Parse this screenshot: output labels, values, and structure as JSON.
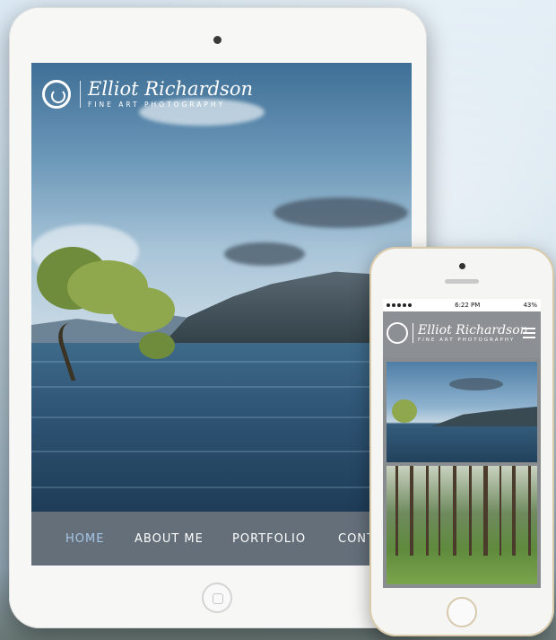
{
  "site": {
    "brand_name": "Elliot Richardson",
    "brand_tagline": "FINE ART PHOTOGRAPHY"
  },
  "ipad": {
    "nav": [
      {
        "label": "HOME",
        "active": true
      },
      {
        "label": "ABOUT ME",
        "active": false
      },
      {
        "label": "PORTFOLIO",
        "active": false
      },
      {
        "label": "CONT",
        "active": false
      }
    ]
  },
  "iphone": {
    "status_time": "6:22 PM",
    "battery": "43%",
    "menu_icon": "hamburger-menu-icon"
  },
  "colors": {
    "nav_active": "#a7c7e8",
    "nav_bg": "#787f87"
  }
}
